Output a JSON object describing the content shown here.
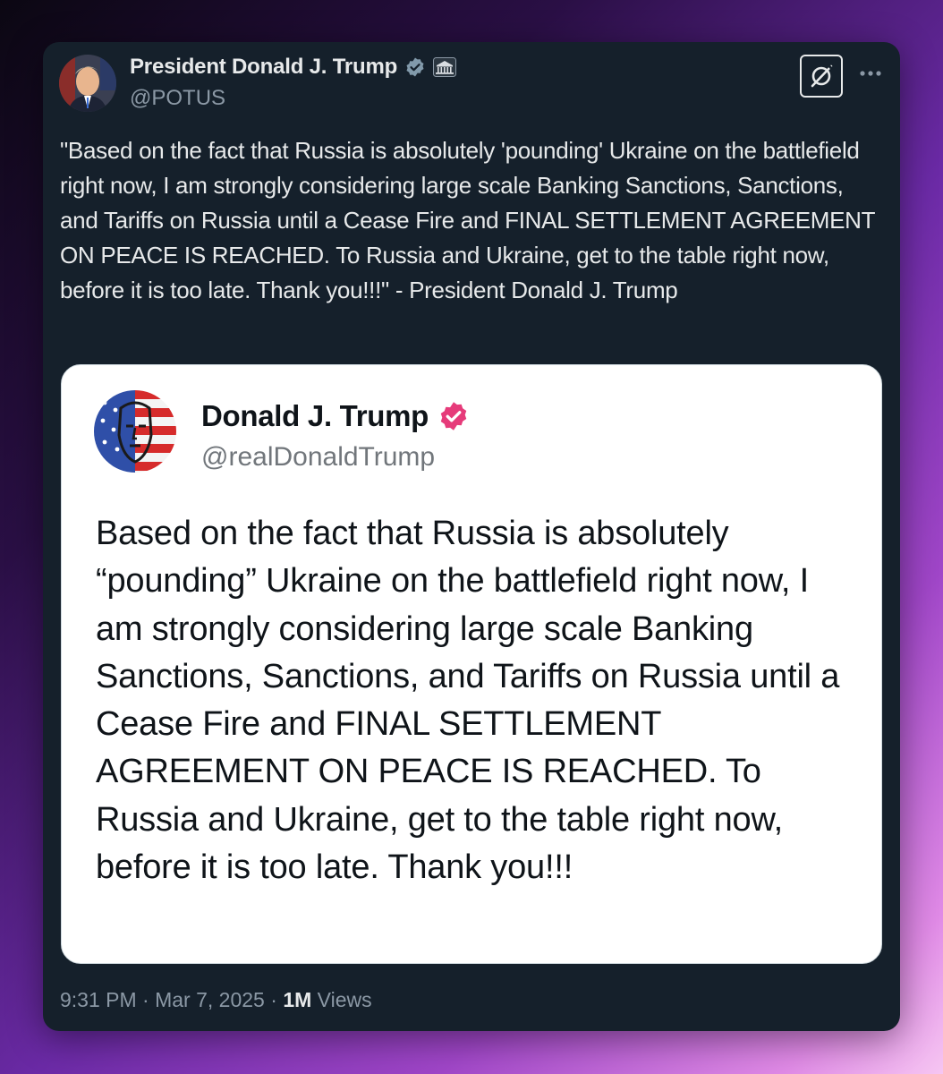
{
  "post": {
    "author_name": "President Donald J. Trump",
    "author_handle": "@POTUS",
    "verified_badge_icon": "gray-verified-badge-icon",
    "affiliation_icon": "white-house-icon",
    "text": "\"Based on the fact that Russia is absolutely 'pounding' Ukraine on the battlefield right now, I am strongly considering large scale Banking Sanctions, Sanctions, and Tariffs on Russia until a Cease Fire and FINAL SETTLEMENT AGREEMENT ON PEACE IS REACHED. To Russia and Ukraine, get to the table right now, before it is too late. Thank you!!!\" - President Donald J. Trump",
    "time": "9:31 PM",
    "separator": "·",
    "date": "Mar 7, 2025",
    "views_count": "1M",
    "views_label": "Views"
  },
  "quoted_post": {
    "author_name": "Donald J. Trump",
    "author_handle": "@realDonaldTrump",
    "verified_badge_icon": "pink-verified-badge-icon",
    "text": "Based on the fact that Russia is absolutely “pounding” Ukraine on the battlefield right now, I am strongly considering large scale Banking Sanctions, Sanctions, and Tariffs on Russia until a Cease Fire and FINAL SETTLEMENT AGREEMENT ON PEACE IS REACHED. To Russia and Ukraine, get to the table right now, before it is too late. Thank you!!!"
  },
  "colors": {
    "card_background": "#15202b",
    "primary_text": "#e7e9ea",
    "secondary_text": "#8b98a5",
    "quote_background": "#ffffff",
    "quote_badge": "#e63b7a"
  },
  "icons": {
    "grok": "grok-icon",
    "more": "more-options-icon"
  }
}
